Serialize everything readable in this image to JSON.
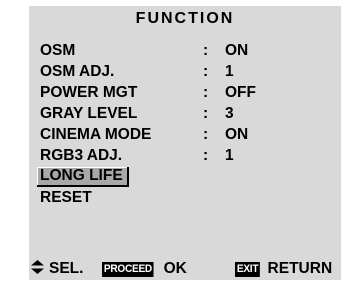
{
  "title": "FUNCTION",
  "menu": {
    "items": [
      {
        "label": "OSM",
        "value": "ON"
      },
      {
        "label": "OSM ADJ.",
        "value": "1"
      },
      {
        "label": "POWER MGT",
        "value": "OFF"
      },
      {
        "label": "GRAY LEVEL",
        "value": "3"
      },
      {
        "label": "CINEMA MODE",
        "value": "ON"
      },
      {
        "label": "RGB3 ADJ.",
        "value": "1"
      },
      {
        "label": "LONG LIFE"
      },
      {
        "label": "RESET"
      }
    ],
    "separator": ":",
    "selected_item": "LONG LIFE"
  },
  "footer": {
    "select_icon": "up-down-arrows-icon",
    "select_label": "SEL.",
    "proceed_key": "PROCEED",
    "proceed_label": "OK",
    "exit_key": "EXIT",
    "exit_label": "RETURN"
  },
  "colors": {
    "panel_background": "#d9d9d9",
    "selection_highlight": "#a8a8a8",
    "key_background": "#000000",
    "key_text": "#ffffff",
    "text": "#000000"
  }
}
